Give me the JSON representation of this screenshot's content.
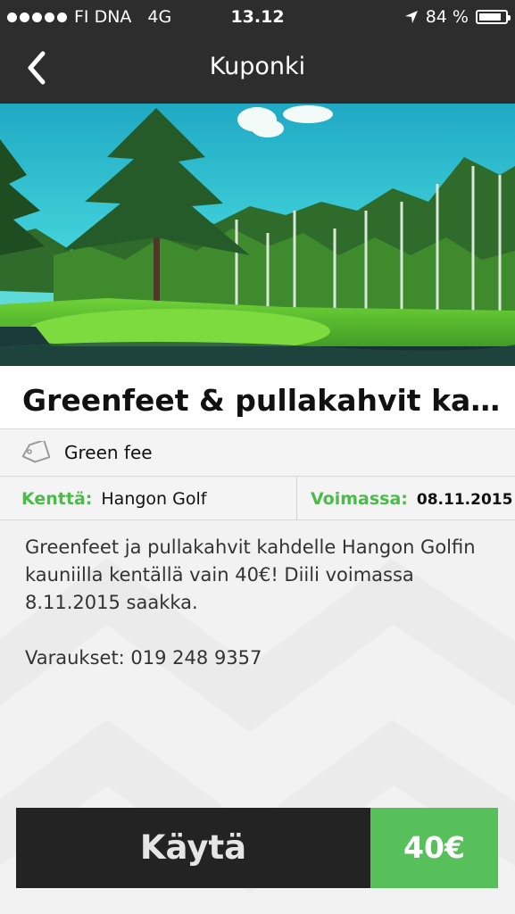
{
  "status_bar": {
    "carrier": "FI DNA",
    "network": "4G",
    "time": "13.12",
    "battery": "84 %",
    "battery_level": 0.84,
    "icons": [
      "signal-dots-icon",
      "location-arrow-icon",
      "battery-icon"
    ]
  },
  "nav": {
    "title": "Kuponki",
    "back_icon": "chevron-left-icon"
  },
  "hero": {
    "image": "golf-course-photo",
    "colors": {
      "sky": "#2fc6d6",
      "grass": "#6fd238",
      "water": "#1a3a3a"
    }
  },
  "coupon": {
    "title": "Greenfeet & pullakahvit kahdelle",
    "category_icon": "tag-icon",
    "category": "Green fee",
    "course_label": "Kenttä:",
    "course_value": "Hangon Golf",
    "valid_label": "Voimassa:",
    "valid_value": "08.11.2015",
    "description": "Greenfeet ja pullakahvit kahdelle Hangon Golfin kauniilla kentällä vain 40€! Diili voimassa 8.11.2015 saakka.",
    "reservations": "Varaukset: 019 248 9357"
  },
  "action": {
    "button_label": "Käytä",
    "price": "40€"
  },
  "colors": {
    "bar": "#2d2d2d",
    "accent_green": "#58c05a",
    "label_green": "#4cbb4c",
    "button_dark": "#232323"
  }
}
